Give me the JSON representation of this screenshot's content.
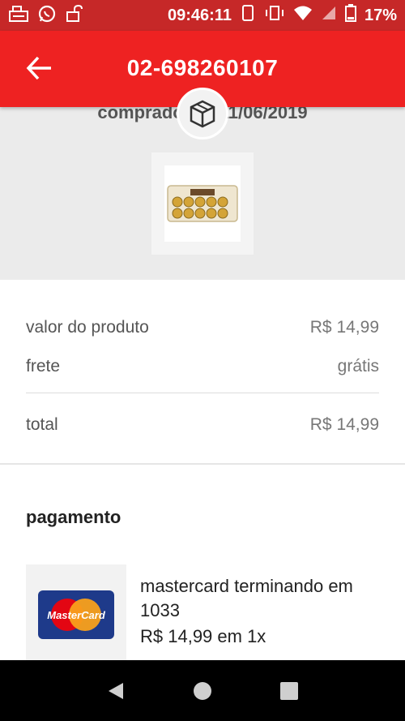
{
  "status_bar": {
    "time": "09:46:11",
    "battery": "17%",
    "icons": [
      "cash-register-icon",
      "whatsapp-icon",
      "lock-icon",
      "vibrate-icon",
      "wifi-icon",
      "signal-icon",
      "battery-icon"
    ]
  },
  "header": {
    "order_number": "02-698260107",
    "back_icon": "arrow-left-icon"
  },
  "order": {
    "purchase_date": "comprado em 11/06/2019",
    "box_icon": "package-box-icon",
    "product_image": "ferrero-rocher-box"
  },
  "summary": {
    "product_value_label": "valor do produto",
    "product_value": "R$ 14,99",
    "shipping_label": "frete",
    "shipping_value": "grátis",
    "total_label": "total",
    "total_value": "R$ 14,99"
  },
  "payment": {
    "heading": "pagamento",
    "card_brand_logo": "MasterCard",
    "card_description": "mastercard terminando em 1033",
    "installments": "R$ 14,99 em 1x"
  },
  "nav": {
    "back": "triangle-back-icon",
    "home": "circle-home-icon",
    "recents": "square-recents-icon"
  },
  "colors": {
    "app_bar": "#ee2222",
    "status_bar": "#c62828",
    "grey_panel": "#ebebeb"
  }
}
